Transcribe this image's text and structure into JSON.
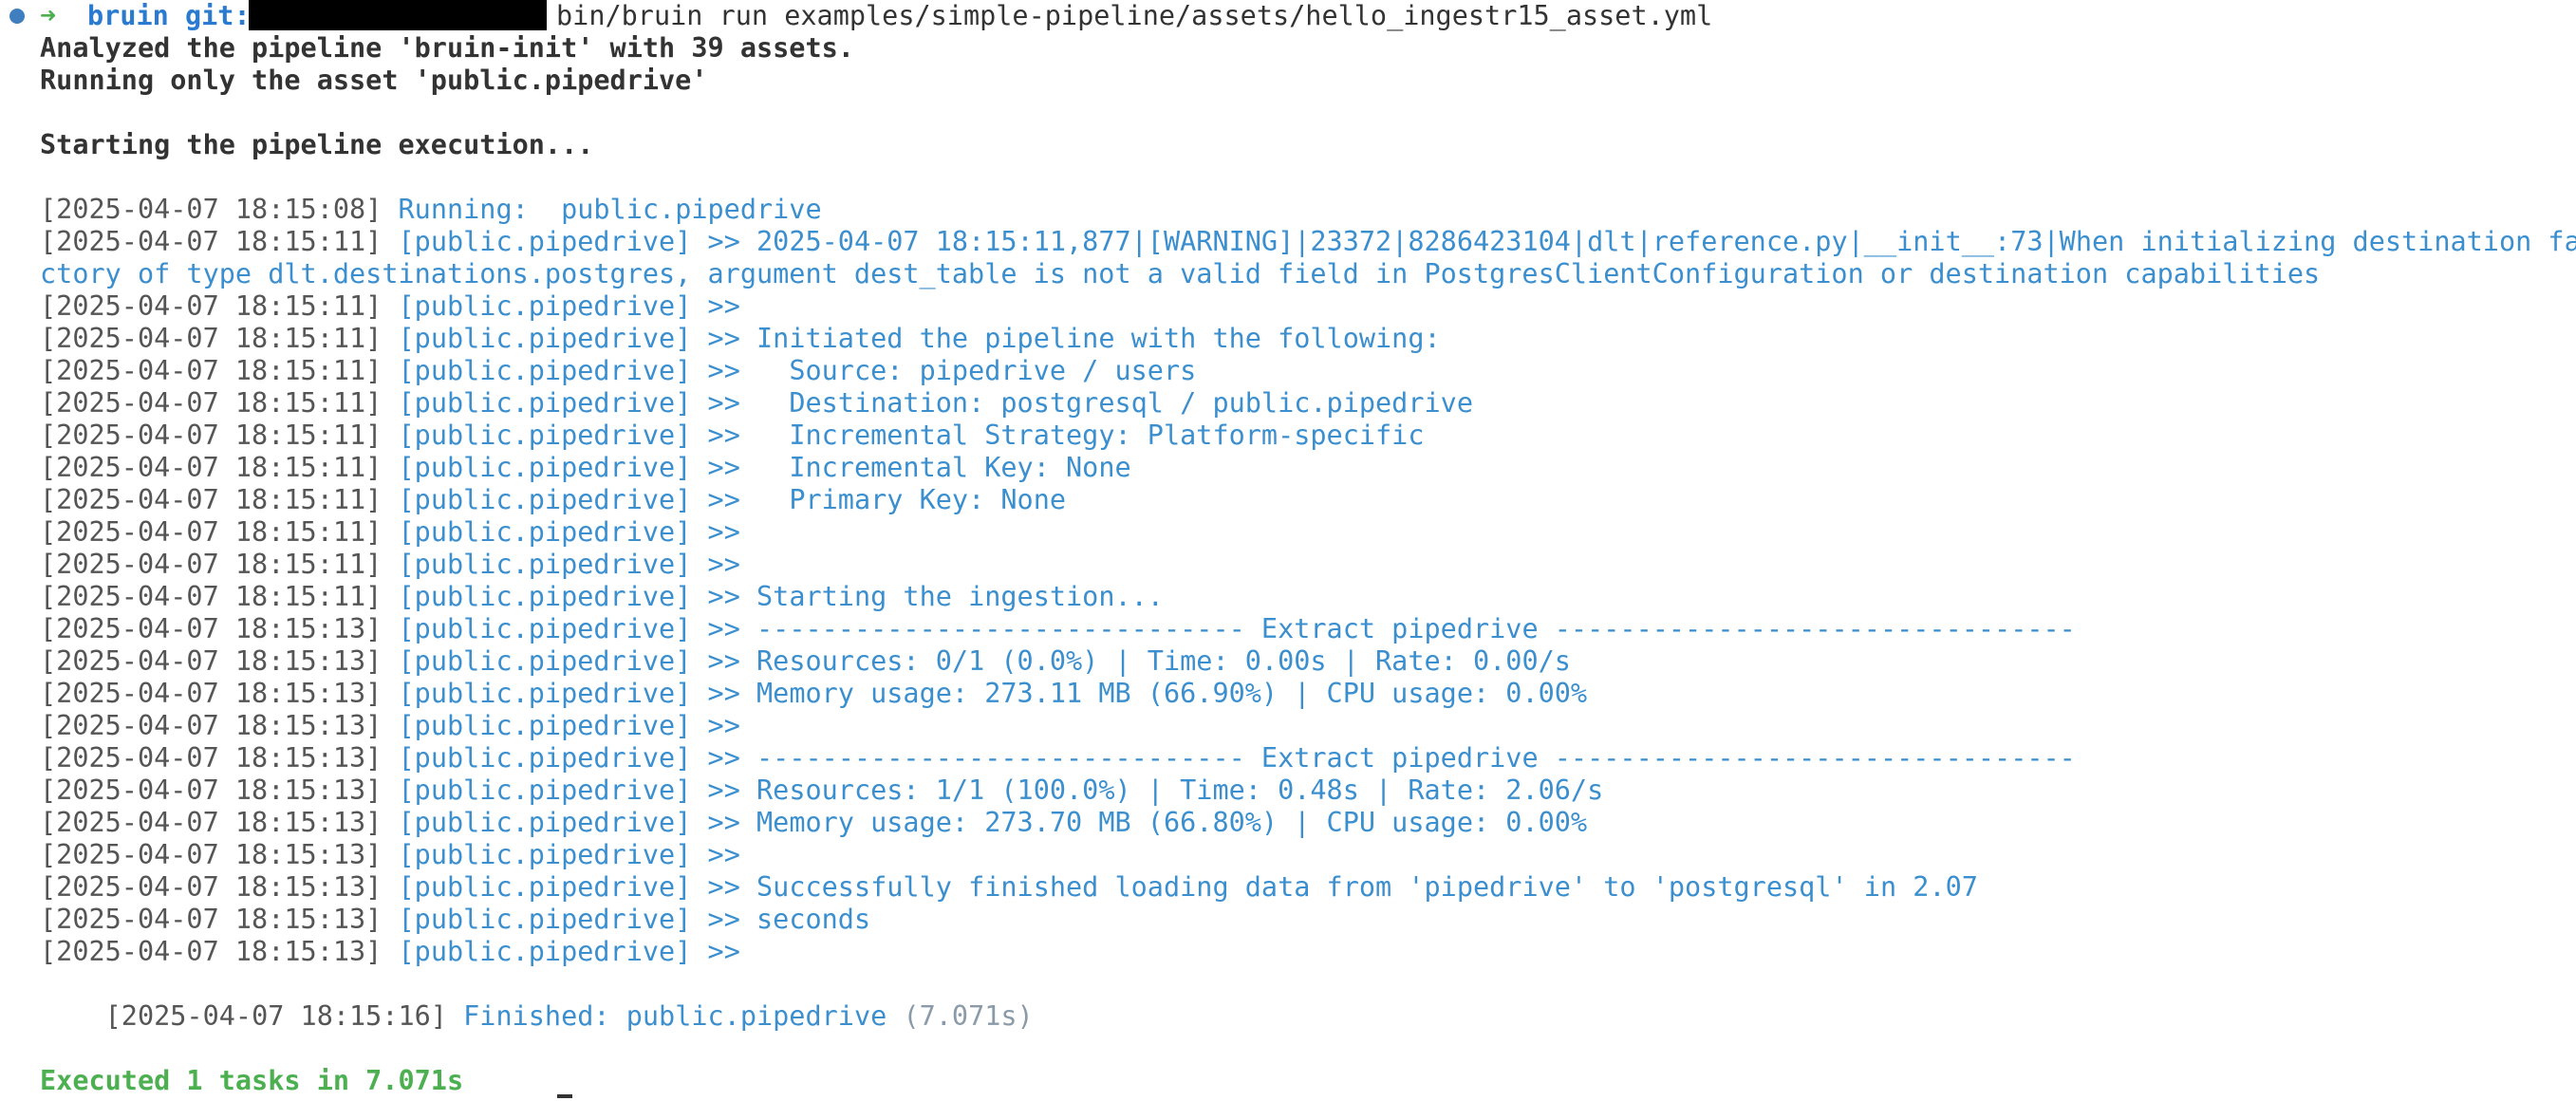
{
  "prompt": {
    "arrow": "➜",
    "dir": "bruin",
    "git_label": "git:",
    "command": "bin/bruin run examples/simple-pipeline/assets/hello_ingestr15_asset.yml"
  },
  "header_lines": [
    "Analyzed the pipeline 'bruin-init' with 39 assets.",
    "Running only the asset 'public.pipedrive'",
    "Starting the pipeline execution..."
  ],
  "log": [
    {
      "ts": "[2025-04-07 18:15:08]",
      "tag": "",
      "text": "Running:  public.pipedrive"
    },
    {
      "ts": "[2025-04-07 18:15:11]",
      "tag": "[public.pipedrive]",
      "text": ">> 2025-04-07 18:15:11,877|[WARNING]|23372|8286423104|dlt|reference.py|__init__:73|When initializing destination fa"
    },
    {
      "ts": "",
      "tag": "",
      "text": "ctory of type dlt.destinations.postgres, argument dest_table is not a valid field in PostgresClientConfiguration or destination capabilities"
    },
    {
      "ts": "[2025-04-07 18:15:11]",
      "tag": "[public.pipedrive]",
      "text": ">>"
    },
    {
      "ts": "[2025-04-07 18:15:11]",
      "tag": "[public.pipedrive]",
      "text": ">> Initiated the pipeline with the following:"
    },
    {
      "ts": "[2025-04-07 18:15:11]",
      "tag": "[public.pipedrive]",
      "text": ">>   Source: pipedrive / users"
    },
    {
      "ts": "[2025-04-07 18:15:11]",
      "tag": "[public.pipedrive]",
      "text": ">>   Destination: postgresql / public.pipedrive"
    },
    {
      "ts": "[2025-04-07 18:15:11]",
      "tag": "[public.pipedrive]",
      "text": ">>   Incremental Strategy: Platform-specific"
    },
    {
      "ts": "[2025-04-07 18:15:11]",
      "tag": "[public.pipedrive]",
      "text": ">>   Incremental Key: None"
    },
    {
      "ts": "[2025-04-07 18:15:11]",
      "tag": "[public.pipedrive]",
      "text": ">>   Primary Key: None"
    },
    {
      "ts": "[2025-04-07 18:15:11]",
      "tag": "[public.pipedrive]",
      "text": ">>"
    },
    {
      "ts": "[2025-04-07 18:15:11]",
      "tag": "[public.pipedrive]",
      "text": ">>"
    },
    {
      "ts": "[2025-04-07 18:15:11]",
      "tag": "[public.pipedrive]",
      "text": ">> Starting the ingestion..."
    },
    {
      "ts": "[2025-04-07 18:15:13]",
      "tag": "[public.pipedrive]",
      "text": ">> ------------------------------ Extract pipedrive --------------------------------"
    },
    {
      "ts": "[2025-04-07 18:15:13]",
      "tag": "[public.pipedrive]",
      "text": ">> Resources: 0/1 (0.0%) | Time: 0.00s | Rate: 0.00/s"
    },
    {
      "ts": "[2025-04-07 18:15:13]",
      "tag": "[public.pipedrive]",
      "text": ">> Memory usage: 273.11 MB (66.90%) | CPU usage: 0.00%"
    },
    {
      "ts": "[2025-04-07 18:15:13]",
      "tag": "[public.pipedrive]",
      "text": ">>"
    },
    {
      "ts": "[2025-04-07 18:15:13]",
      "tag": "[public.pipedrive]",
      "text": ">> ------------------------------ Extract pipedrive --------------------------------"
    },
    {
      "ts": "[2025-04-07 18:15:13]",
      "tag": "[public.pipedrive]",
      "text": ">> Resources: 1/1 (100.0%) | Time: 0.48s | Rate: 2.06/s"
    },
    {
      "ts": "[2025-04-07 18:15:13]",
      "tag": "[public.pipedrive]",
      "text": ">> Memory usage: 273.70 MB (66.80%) | CPU usage: 0.00%"
    },
    {
      "ts": "[2025-04-07 18:15:13]",
      "tag": "[public.pipedrive]",
      "text": ">>"
    },
    {
      "ts": "[2025-04-07 18:15:13]",
      "tag": "[public.pipedrive]",
      "text": ">> Successfully finished loading data from 'pipedrive' to 'postgresql' in 2.07"
    },
    {
      "ts": "[2025-04-07 18:15:13]",
      "tag": "[public.pipedrive]",
      "text": ">> seconds"
    },
    {
      "ts": "[2025-04-07 18:15:13]",
      "tag": "[public.pipedrive]",
      "text": ">>"
    }
  ],
  "finished": {
    "ts": "[2025-04-07 18:15:16]",
    "text": "Finished: public.pipedrive",
    "duration": "(7.071s)"
  },
  "summary": "Executed 1 tasks in 7.071s"
}
